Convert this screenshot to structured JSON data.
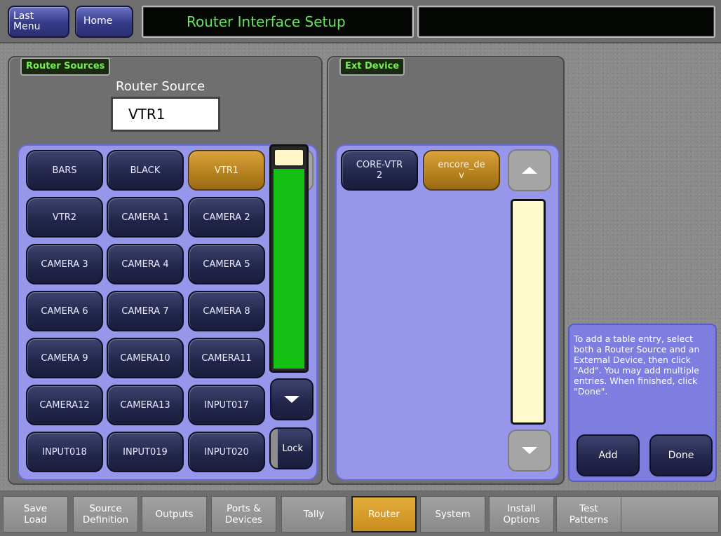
{
  "header": {
    "last_menu_label": "Last\nMenu",
    "home_label": "Home",
    "title": "Router Interface Setup",
    "status": ""
  },
  "router_sources": {
    "tag": "Router Sources",
    "field_label": "Router Source",
    "field_value": "VTR1",
    "buttons": [
      {
        "label": "BARS",
        "selected": false
      },
      {
        "label": "BLACK",
        "selected": false
      },
      {
        "label": "VTR1",
        "selected": true
      },
      {
        "label": "VTR2",
        "selected": false
      },
      {
        "label": "CAMERA 1",
        "selected": false
      },
      {
        "label": "CAMERA 2",
        "selected": false
      },
      {
        "label": "CAMERA 3",
        "selected": false
      },
      {
        "label": "CAMERA 4",
        "selected": false
      },
      {
        "label": "CAMERA 5",
        "selected": false
      },
      {
        "label": "CAMERA 6",
        "selected": false
      },
      {
        "label": "CAMERA 7",
        "selected": false
      },
      {
        "label": "CAMERA 8",
        "selected": false
      },
      {
        "label": "CAMERA 9",
        "selected": false
      },
      {
        "label": "CAMERA10",
        "selected": false
      },
      {
        "label": "CAMERA11",
        "selected": false
      },
      {
        "label": "CAMERA12",
        "selected": false
      },
      {
        "label": "CAMERA13",
        "selected": false
      },
      {
        "label": "INPUT017",
        "selected": false
      },
      {
        "label": "INPUT018",
        "selected": false
      },
      {
        "label": "INPUT019",
        "selected": false
      },
      {
        "label": "INPUT020",
        "selected": false
      }
    ],
    "lock_label": "Lock"
  },
  "ext_device": {
    "tag": "Ext Device",
    "buttons": [
      {
        "label": "CORE-VTR\n2",
        "selected": false
      },
      {
        "label": "encore_de\nv",
        "selected": true
      }
    ]
  },
  "help": {
    "text": "To add a table entry, select both a Router Source and an External Device, then click \"Add\". You may add multiple entries.  When finished, click \"Done\".",
    "add_label": "Add",
    "done_label": "Done"
  },
  "tabs": [
    {
      "label": "Save\nLoad",
      "active": false
    },
    {
      "label": "Source\nDefinition",
      "active": false
    },
    {
      "label": "Outputs",
      "active": false
    },
    {
      "label": "Ports &\nDevices",
      "active": false
    },
    {
      "label": "Tally",
      "active": false
    },
    {
      "label": "Router",
      "active": true
    },
    {
      "label": "System",
      "active": false
    },
    {
      "label": "Install\nOptions",
      "active": false
    },
    {
      "label": "Test\nPatterns",
      "active": false
    }
  ],
  "colors": {
    "accent_selected": "#c98c1d",
    "title_green": "#62e65a",
    "grid_blue": "#9696ea"
  }
}
